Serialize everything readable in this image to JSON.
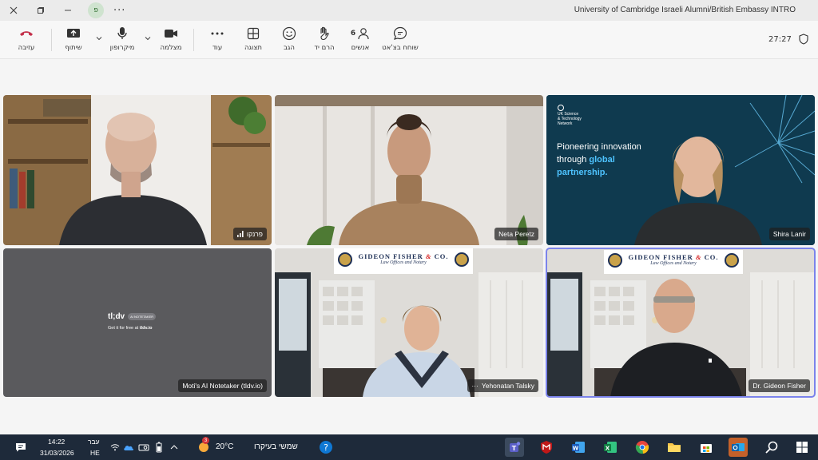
{
  "window": {
    "title": "University of Cambridge Israeli Alumni/British Embassy INTRO",
    "avatar_initial": "פ",
    "more_label": "···"
  },
  "toolbar": {
    "leave_label": "עזיבה",
    "share_label": "שיתוף",
    "mic_label": "מיקרופון",
    "camera_label": "מצלמה",
    "more_label": "עוד",
    "view_label": "תצוגה",
    "react_label": "הגב",
    "raise_label": "הרם יד",
    "people_label": "אנשים",
    "people_count": "6",
    "chat_label": "שוחח בצ'אט",
    "timer": "27:27"
  },
  "participants": [
    {
      "name": "פרנקו"
    },
    {
      "name": "Neta Peretz"
    },
    {
      "name": "Shira Lanir"
    },
    {
      "name": "Moti's AI Notetaker (tldv.io)"
    },
    {
      "name": "Yehonatan Talsky"
    },
    {
      "name": "Dr. Gideon Fisher"
    }
  ],
  "slide": {
    "org_line1": "UK Science",
    "org_line2": "& Technology",
    "org_line3": "Network",
    "line1": "Pioneering innovation",
    "line2_plain": "through ",
    "line2_accent": "global",
    "line3_accent": "partnership."
  },
  "tldv": {
    "logo": "tl;dv",
    "badge": "AI NOTETAKER",
    "tagline_plain": "Get it for free at ",
    "tagline_bold": "tldv.io"
  },
  "banner": {
    "firm_a": "GIDEON FISHER ",
    "firm_amp": "&",
    "firm_b": " CO.",
    "sub": "Law Offices and Notary"
  },
  "taskbar": {
    "time": "14:22",
    "date": "31/03/2026",
    "lang_top": "עבר",
    "lang_bottom": "HE",
    "weather_temp": "20°C",
    "weather_desc": "שמשי בעיקרו",
    "weather_badge": "3"
  },
  "colors": {
    "leave_red": "#c4314b",
    "teams_purple": "#5b5fc7",
    "taskbar_bg": "#1e2a3a",
    "slide_accent": "#4ec3ff"
  }
}
